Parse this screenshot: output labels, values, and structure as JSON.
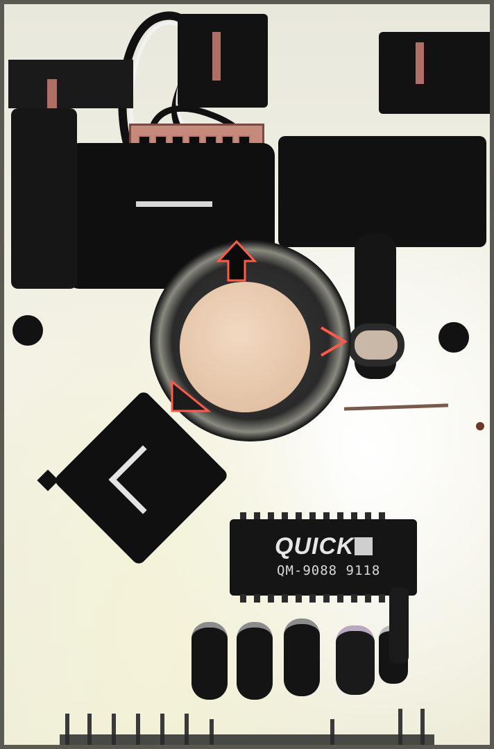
{
  "photo": {
    "subject": "circuit-board-closeup",
    "colors": {
      "board": "#efeee2",
      "component": "#121212",
      "copper": "#b47a6c",
      "speaker_cone": "#e6c8ad",
      "arrow": "#ff5a4a",
      "frame": "#5a5a52"
    }
  },
  "ic_chip": {
    "brand": "QUICK",
    "part_number": "QM-9088 9118"
  }
}
